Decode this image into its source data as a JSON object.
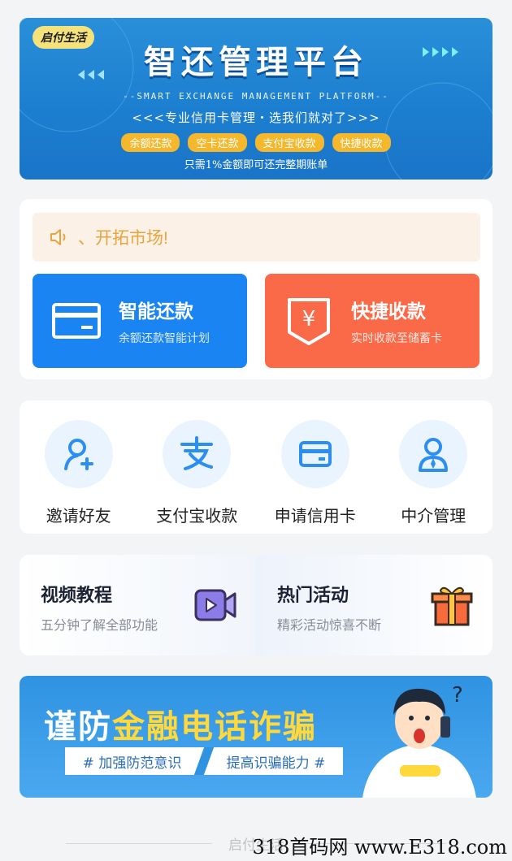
{
  "banner": {
    "badge": "启付生活",
    "title": "智还管理平台",
    "subtitle_en": "--SMART EXCHANGE MANAGEMENT PLATFORM--",
    "tagline": "<<<专业信用卡管理・选我们就对了>>>",
    "chips": [
      "余额还款",
      "空卡还款",
      "支付宝收款",
      "快捷收款"
    ],
    "note": "只需1%金额即可还完整期账单"
  },
  "notice": {
    "text": "、开拓市场!"
  },
  "actions": {
    "smart_repay": {
      "title": "智能还款",
      "subtitle": "余额还款智能计划",
      "color": "#1a85f2"
    },
    "quick_collect": {
      "title": "快捷收款",
      "subtitle": "实时收款至储蓄卡",
      "color": "#fb6a48"
    }
  },
  "grid": [
    {
      "label": "邀请好友",
      "icon": "invite-user-icon"
    },
    {
      "label": "支付宝收款",
      "icon": "alipay-icon"
    },
    {
      "label": "申请信用卡",
      "icon": "credit-card-icon"
    },
    {
      "label": "中介管理",
      "icon": "agent-icon"
    }
  ],
  "promo": {
    "video": {
      "title": "视频教程",
      "subtitle": "五分钟了解全部功能",
      "icon": "video-camera-icon"
    },
    "hot": {
      "title": "热门活动",
      "subtitle": "精彩活动惊喜不断",
      "icon": "gift-icon"
    }
  },
  "fraud_banner": {
    "title_prefix": "谨防",
    "title_highlight": "金融电话诈骗",
    "tag1": "# 加强防范意识",
    "tag2": "提高识骗能力 #"
  },
  "footer": {
    "text": "启付生活"
  },
  "watermark": "318首码网 www.E318.com"
}
